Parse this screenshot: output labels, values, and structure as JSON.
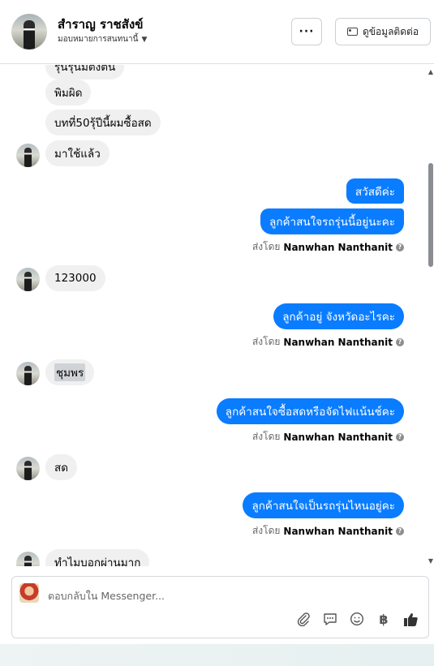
{
  "header": {
    "name": "สำราญ ราชสังข์",
    "subtitle": "มอบหมายการสนทนานี้",
    "more_label": "···",
    "contact_label": "ดูข้อมูลติดต่อ"
  },
  "messages": [
    {
      "id": "m0",
      "side": "in",
      "text": "รุ่นรุ่นมีตั้งต้น",
      "avatar": false
    },
    {
      "id": "m1",
      "side": "in",
      "text": "พิมผิด",
      "avatar": false
    },
    {
      "id": "m2",
      "side": "in",
      "text": "บทที่50รุ้ปีนี้ผมซื้อสด",
      "avatar": false
    },
    {
      "id": "m3",
      "side": "in",
      "text": "มาใช้แล้ว",
      "avatar": true
    },
    {
      "id": "m4",
      "side": "out",
      "text": "สวัสดีค่ะ"
    },
    {
      "id": "m5",
      "side": "out",
      "text": "ลูกค้าสนใจรถรุ่นนี้อยู่นะคะ"
    },
    {
      "id": "m6",
      "side": "in",
      "text": "123000",
      "avatar": true
    },
    {
      "id": "m7",
      "side": "out",
      "text": "ลูกค้าอยู่ จังหวัดอะไรคะ"
    },
    {
      "id": "m8",
      "side": "in",
      "text": "ชุมพร",
      "avatar": true
    },
    {
      "id": "m9",
      "side": "out",
      "text": "ลูกค้าสนใจซื้อสดหรือจัดไฟแน้นช์คะ"
    },
    {
      "id": "m10",
      "side": "in",
      "text": "สด",
      "avatar": true
    },
    {
      "id": "m11",
      "side": "out",
      "text": "ลูกค้าสนใจเป็นรถรุ่นไหนอยู่คะ"
    },
    {
      "id": "m12",
      "side": "in",
      "text": "ทำไมบอกผ่านมาก",
      "avatar": true
    }
  ],
  "sent_by": {
    "prefix": "ส่งโดย",
    "agent": "Nanwhan Nanthanit",
    "help_icon": "?"
  },
  "composer": {
    "placeholder": "ตอบกลับใน Messenger...",
    "tools": [
      "attachment-icon",
      "saved-reply-icon",
      "emoji-icon",
      "baht-icon",
      "like-icon"
    ]
  },
  "colors": {
    "outgoing_bubble": "#0a7cff",
    "incoming_bubble": "#f0f0f0",
    "muted_text": "#65676b"
  }
}
